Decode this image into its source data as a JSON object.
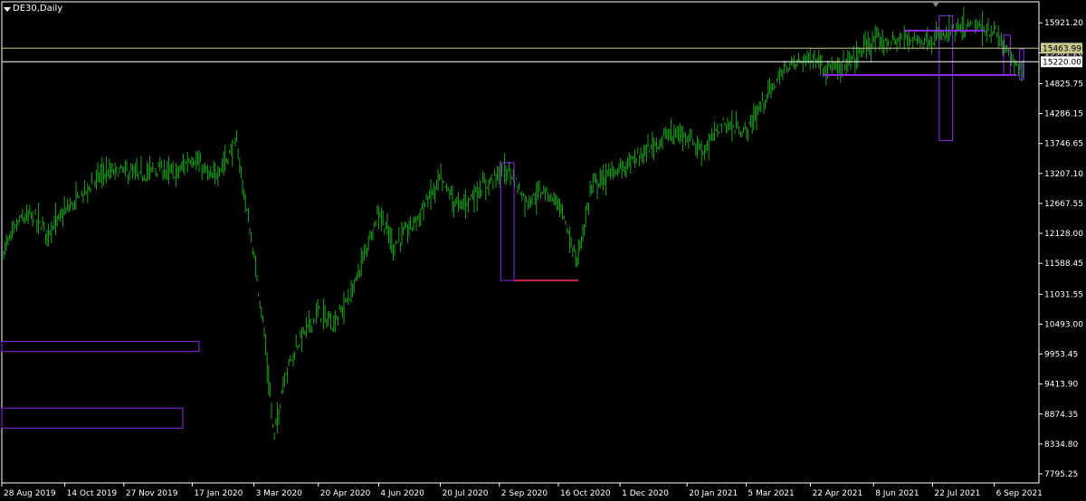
{
  "chart_data": {
    "type": "candlestick",
    "title": "DE30,Daily",
    "symbol": "DE30",
    "timeframe": "Daily",
    "ylim": [
      7795.25,
      16200
    ],
    "y_ticks": [
      15921.2,
      15381.2,
      14825.75,
      14286.15,
      13746.65,
      13207.1,
      12667.55,
      12128.0,
      11588.45,
      11031.55,
      10493.0,
      9953.45,
      9413.9,
      8874.35,
      8334.8,
      7795.25
    ],
    "y_tick_labels": [
      "15921.20",
      "15381.20",
      "14825.75",
      "14286.15",
      "13746.65",
      "13207.10",
      "12667.55",
      "12128.00",
      "11588.45",
      "11031.55",
      "10493.00",
      "9953.45",
      "9413.90",
      "8874.35",
      "8334.80",
      "7795.25"
    ],
    "x_tick_labels": [
      "28 Aug 2019",
      "14 Oct 2019",
      "27 Nov 2019",
      "17 Jan 2020",
      "3 Mar 2020",
      "20 Apr 2020",
      "4 Jun 2020",
      "20 Jul 2020",
      "2 Sep 2020",
      "16 Oct 2020",
      "1 Dec 2020",
      "20 Jan 2021",
      "5 Mar 2021",
      "22 Apr 2021",
      "8 Jun 2021",
      "22 Jul 2021",
      "6 Sep 2021"
    ],
    "price_levels": [
      {
        "value": 15463.99,
        "label": "15463.99",
        "color": "#c8c88c"
      },
      {
        "value": 15220.0,
        "label": "15220.00",
        "color": "#ffffff"
      }
    ],
    "bar_color": "#1ea01e",
    "grid": false,
    "series": [
      {
        "values": [
          [
            "2019-08-28",
            11750
          ],
          [
            "2019-09-10",
            12350
          ],
          [
            "2019-09-20",
            12450
          ],
          [
            "2019-10-01",
            12150
          ],
          [
            "2019-10-14",
            12500
          ],
          [
            "2019-10-30",
            12900
          ],
          [
            "2019-11-10",
            13200
          ],
          [
            "2019-11-27",
            13250
          ],
          [
            "2019-12-10",
            13150
          ],
          [
            "2019-12-20",
            13300
          ],
          [
            "2020-01-05",
            13200
          ],
          [
            "2020-01-17",
            13500
          ],
          [
            "2020-02-01",
            13100
          ],
          [
            "2020-02-19",
            13750
          ],
          [
            "2020-02-25",
            12800
          ],
          [
            "2020-03-03",
            11700
          ],
          [
            "2020-03-10",
            10500
          ],
          [
            "2020-03-18",
            8450
          ],
          [
            "2020-03-26",
            9600
          ],
          [
            "2020-04-08",
            10300
          ],
          [
            "2020-04-20",
            10700
          ],
          [
            "2020-05-01",
            10500
          ],
          [
            "2020-05-15",
            11050
          ],
          [
            "2020-06-04",
            12550
          ],
          [
            "2020-06-15",
            11900
          ],
          [
            "2020-06-30",
            12300
          ],
          [
            "2020-07-20",
            13100
          ],
          [
            "2020-08-03",
            12600
          ],
          [
            "2020-08-20",
            12950
          ],
          [
            "2020-09-02",
            13200
          ],
          [
            "2020-09-10",
            13250
          ],
          [
            "2020-09-22",
            12700
          ],
          [
            "2020-10-05",
            12900
          ],
          [
            "2020-10-16",
            12700
          ],
          [
            "2020-10-30",
            11600
          ],
          [
            "2020-11-10",
            13000
          ],
          [
            "2020-12-01",
            13300
          ],
          [
            "2020-12-15",
            13500
          ],
          [
            "2021-01-05",
            13900
          ],
          [
            "2021-01-20",
            13900
          ],
          [
            "2021-02-01",
            13600
          ],
          [
            "2021-02-15",
            14100
          ],
          [
            "2021-03-05",
            13950
          ],
          [
            "2021-03-20",
            14600
          ],
          [
            "2021-04-05",
            15150
          ],
          [
            "2021-04-22",
            15300
          ],
          [
            "2021-05-12",
            15050
          ],
          [
            "2021-06-08",
            15600
          ],
          [
            "2021-06-20",
            15550
          ],
          [
            "2021-07-05",
            15650
          ],
          [
            "2021-07-22",
            15600
          ],
          [
            "2021-08-05",
            15750
          ],
          [
            "2021-08-20",
            15850
          ],
          [
            "2021-09-06",
            15750
          ],
          [
            "2021-09-15",
            15450
          ],
          [
            "2021-09-23",
            15100
          ],
          [
            "2021-09-28",
            15220
          ]
        ]
      }
    ],
    "annotations": [
      {
        "kind": "rect",
        "color": "#8a2be2",
        "x0": "2019-08-28",
        "x1": "2020-01-22",
        "y0": 10000,
        "y1": 10180
      },
      {
        "kind": "rect",
        "color": "#8a2be2",
        "x0": "2019-08-28",
        "x1": "2020-01-10",
        "y0": 8620,
        "y1": 8980
      },
      {
        "kind": "rect",
        "color": "#8a2be2",
        "x0": "2020-09-03",
        "x1": "2020-09-13",
        "y0": 11280,
        "y1": 13400
      },
      {
        "kind": "rect",
        "color": "#cc2244",
        "x0": "2020-09-13",
        "x1": "2020-10-31",
        "y0": 11280,
        "y1": 11280
      },
      {
        "kind": "rect",
        "color": "#8a2be2",
        "x0": "2021-05-01",
        "x1": "2021-09-23",
        "y0": 14980,
        "y1": 14980
      },
      {
        "kind": "rect",
        "color": "#8a2be2",
        "x0": "2021-07-01",
        "x1": "2021-08-30",
        "y0": 15780,
        "y1": 15780
      },
      {
        "kind": "rect",
        "color": "#8a2be2",
        "x0": "2021-07-27",
        "x1": "2021-08-06",
        "y0": 13800,
        "y1": 16050
      },
      {
        "kind": "rect",
        "color": "#8a2be2",
        "x0": "2021-09-13",
        "x1": "2021-09-18",
        "y0": 14980,
        "y1": 15700
      },
      {
        "kind": "rect",
        "color": "#8a2be2",
        "x0": "2021-09-25",
        "x1": "2021-09-28",
        "y0": 14900,
        "y1": 15450
      }
    ]
  }
}
